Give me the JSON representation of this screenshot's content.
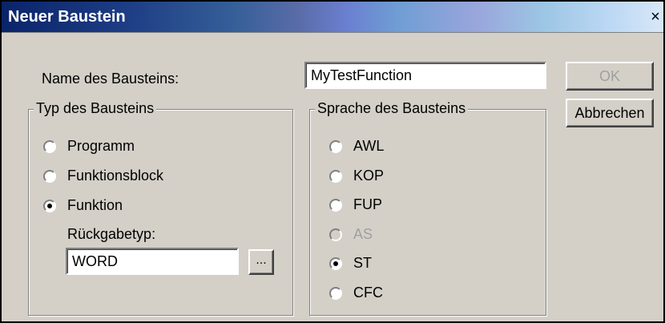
{
  "window": {
    "title": "Neuer Baustein",
    "close_glyph": "×"
  },
  "name_field": {
    "label": "Name des Bausteins:",
    "value": "MyTestFunction"
  },
  "buttons": {
    "ok": "OK",
    "cancel": "Abbrechen",
    "browse": "..."
  },
  "type_group": {
    "title": "Typ des Bausteins",
    "options": [
      {
        "label": "Programm",
        "checked": false
      },
      {
        "label": "Funktionsblock",
        "checked": false
      },
      {
        "label": "Funktion",
        "checked": true
      }
    ],
    "return_type_label": "Rückgabetyp:",
    "return_type_value": "WORD"
  },
  "language_group": {
    "title": "Sprache des Bausteins",
    "options": [
      {
        "label": "AWL",
        "checked": false,
        "disabled": false
      },
      {
        "label": "KOP",
        "checked": false,
        "disabled": false
      },
      {
        "label": "FUP",
        "checked": false,
        "disabled": false
      },
      {
        "label": "AS",
        "checked": false,
        "disabled": true
      },
      {
        "label": "ST",
        "checked": true,
        "disabled": false
      },
      {
        "label": "CFC",
        "checked": false,
        "disabled": false
      }
    ]
  }
}
